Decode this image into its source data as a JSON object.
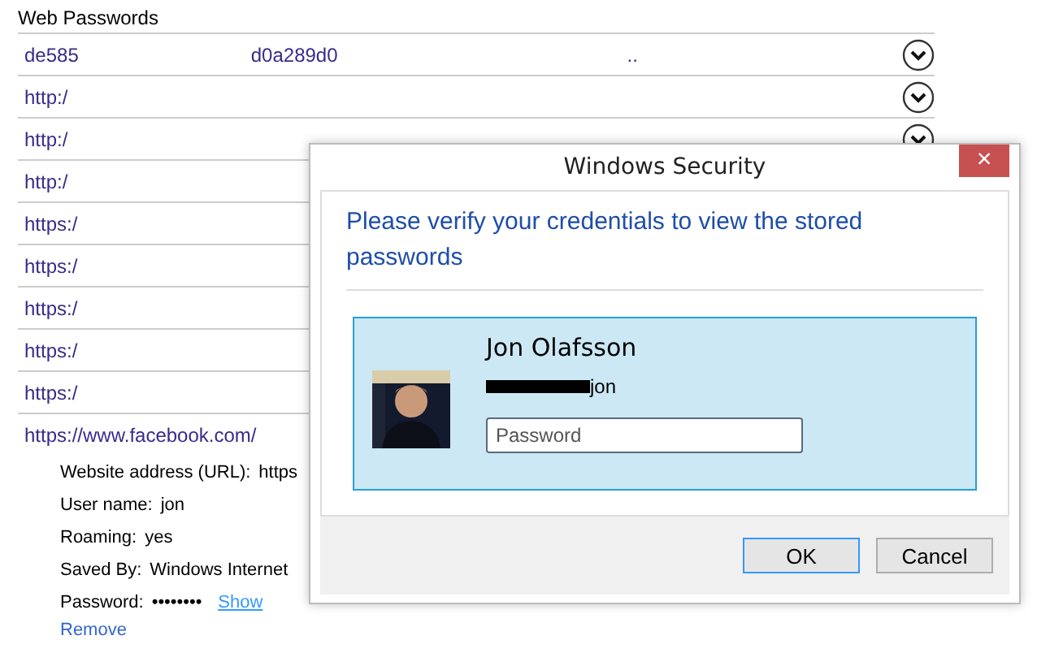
{
  "section_title": "Web Passwords",
  "rows": [
    {
      "texts": [
        "de585",
        "d0a289d0",
        ".."
      ],
      "expand_icon": true
    },
    {
      "texts": [
        "http:/"
      ],
      "expand_icon": true
    },
    {
      "texts": [
        "http:/"
      ],
      "expand_icon": true
    },
    {
      "texts": [
        "http:/"
      ],
      "expand_icon": false
    },
    {
      "texts": [
        "https:/"
      ],
      "expand_icon": false
    },
    {
      "texts": [
        "https:/"
      ],
      "expand_icon": false
    },
    {
      "texts": [
        "https:/"
      ],
      "expand_icon": false
    },
    {
      "texts": [
        "https:/"
      ],
      "expand_icon": false
    },
    {
      "texts": [
        "https:/"
      ],
      "expand_icon": false
    }
  ],
  "expanded_entry": {
    "url": "https://www.facebook.com/",
    "details": [
      {
        "label": "Website address (URL):",
        "value": "https"
      },
      {
        "label": "User name:",
        "value": "jon"
      },
      {
        "label": "Roaming:",
        "value": "yes"
      },
      {
        "label": "Saved By:",
        "value": "Windows Internet"
      },
      {
        "label": "Password:",
        "value": "••••••••",
        "link": "Show"
      }
    ],
    "remove_link": "Remove"
  },
  "dialog": {
    "title": "Windows Security",
    "close": "×",
    "message": "Please verify your credentials to view the stored passwords",
    "account": {
      "name": "Jon Olafsson",
      "user": "jon",
      "password_placeholder": "Password"
    },
    "buttons": [
      {
        "label": "OK",
        "default": true
      },
      {
        "label": "Cancel",
        "default": false
      }
    ]
  }
}
